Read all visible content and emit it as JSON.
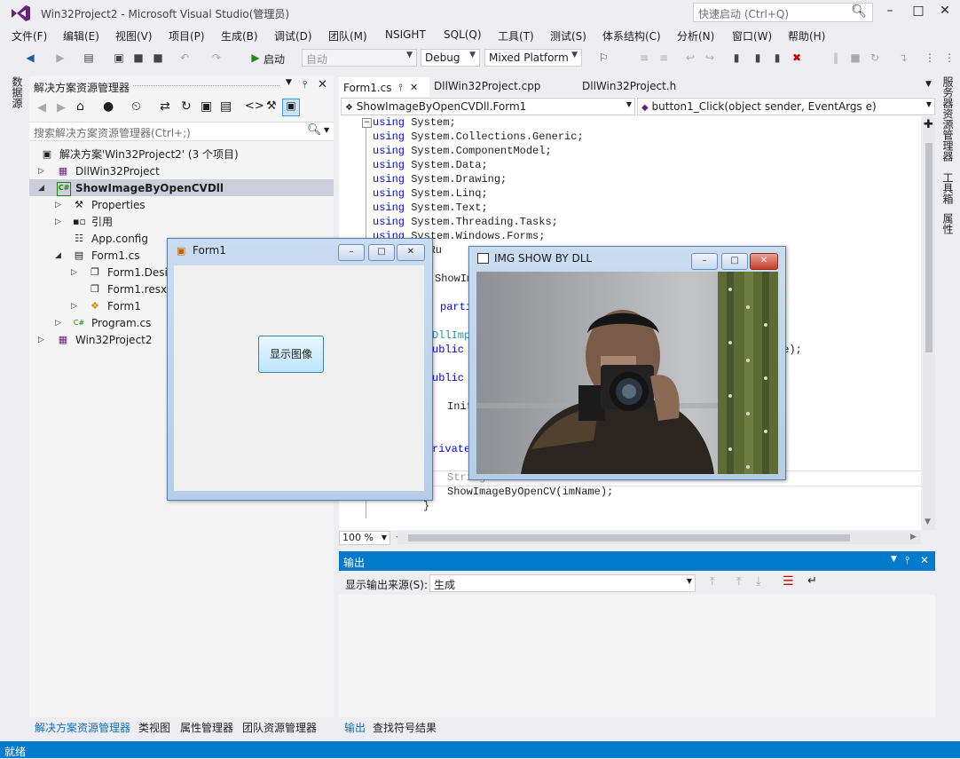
{
  "app": {
    "title": "Win32Project2 - Microsoft Visual Studio(管理员)",
    "quick_launch_placeholder": "快速启动 (Ctrl+Q)"
  },
  "menu": [
    "文件(F)",
    "编辑(E)",
    "视图(V)",
    "项目(P)",
    "生成(B)",
    "调试(D)",
    "团队(M)",
    "NSIGHT",
    "SQL(Q)",
    "工具(T)",
    "测试(S)",
    "体系结构(C)",
    "分析(N)",
    "窗口(W)",
    "帮助(H)"
  ],
  "toolbar": {
    "start_label": "启动",
    "target_combo": "自动",
    "config_combo": "Debug",
    "platform_combo": "Mixed Platform"
  },
  "left_vtab": "数据源",
  "solution_explorer": {
    "title": "解决方案资源管理器",
    "search_placeholder": "搜索解决方案资源管理器(Ctrl+;)",
    "tree": [
      {
        "label": "解决方案'Win32Project2' (3 个项目)",
        "icon": "solution-icon"
      },
      {
        "label": "DllWin32Project",
        "icon": "cpp-project-icon"
      },
      {
        "label": "ShowImageByOpenCVDll",
        "icon": "csharp-project-icon"
      },
      {
        "label": "Properties",
        "icon": "wrench-icon"
      },
      {
        "label": "引用",
        "icon": "references-icon"
      },
      {
        "label": "App.config",
        "icon": "config-file-icon"
      },
      {
        "label": "Form1.cs",
        "icon": "form-icon"
      },
      {
        "label": "Form1.Designer.cs",
        "icon": "cs-file-icon"
      },
      {
        "label": "Form1.resx",
        "icon": "resx-file-icon"
      },
      {
        "label": "Form1",
        "icon": "class-icon"
      },
      {
        "label": "Program.cs",
        "icon": "csharp-file-icon"
      },
      {
        "label": "Win32Project2",
        "icon": "cpp-project-icon"
      }
    ],
    "bottom_tabs": [
      "解决方案资源管理器",
      "类视图",
      "属性管理器",
      "团队资源管理器"
    ]
  },
  "editor": {
    "tabs": [
      "Form1.cs",
      "DllWin32Project.cpp",
      "DllWin32Project.h"
    ],
    "nav_left": "ShowImageByOpenCVDll.Form1",
    "nav_right": "button1_Click(object sender, EventArgs e)",
    "zoom": "100 %",
    "usings": [
      "System",
      "System.Collections.Generic",
      "System.ComponentModel",
      "System.Data",
      "System.Drawing",
      "System.Linq",
      "System.Text",
      "System.Threading.Tasks",
      "System.Windows.Forms"
    ],
    "fragments": {
      "ru": "em.Ru",
      "show_i": "ShowIm",
      "parti": "parti",
      "dllimp": "DllImpo",
      "ublic1": "ublic",
      "ne": "ne);",
      "ublic2": "ublic F",
      "init": "Init",
      "rivate": "rivate",
      "string_line": "String imName = ...",
      "show_call": "ShowImageByOpenCV(imName);",
      "close_brace": "}"
    }
  },
  "output": {
    "title": "输出",
    "source_label": "显示输出来源(S):",
    "source_value": "生成",
    "bottom_tabs": [
      "输出",
      "查找符号结果"
    ]
  },
  "right_vtabs": [
    "服务器资源管理器",
    "工具箱",
    "属性"
  ],
  "status": "就绪",
  "form1": {
    "title": "Form1",
    "button_label": "显示图像"
  },
  "img_window": {
    "title": "IMG SHOW BY DLL"
  }
}
